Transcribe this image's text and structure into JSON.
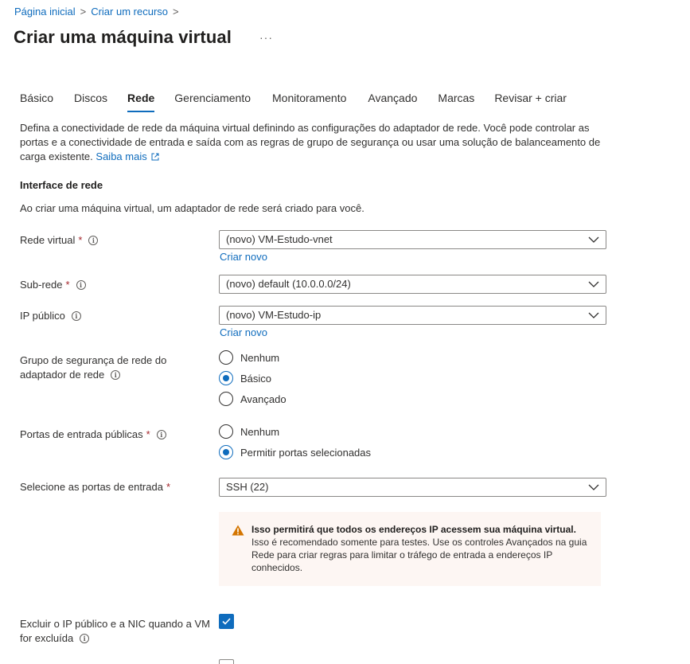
{
  "breadcrumb": {
    "home": "Página inicial",
    "create": "Criar um recurso"
  },
  "page": {
    "title": "Criar uma máquina virtual",
    "more": "···"
  },
  "tabs": [
    {
      "label": "Básico"
    },
    {
      "label": "Discos"
    },
    {
      "label": "Rede"
    },
    {
      "label": "Gerenciamento"
    },
    {
      "label": "Monitoramento"
    },
    {
      "label": "Avançado"
    },
    {
      "label": "Marcas"
    },
    {
      "label": "Revisar + criar"
    }
  ],
  "active_tab": "Rede",
  "description": {
    "text": "Defina a conectividade de rede da máquina virtual definindo as configurações do adaptador de rede. Você pode controlar as portas e a conectividade de entrada e saída com as regras de grupo de segurança ou usar uma solução de balanceamento de carga existente.",
    "link": "Saiba mais"
  },
  "section": {
    "title": "Interface de rede",
    "description": "Ao criar uma máquina virtual, um adaptador de rede será criado para você."
  },
  "fields": {
    "vnet": {
      "label": "Rede virtual",
      "required": "*",
      "value": "(novo) VM-Estudo-vnet",
      "create_link": "Criar novo"
    },
    "subnet": {
      "label": "Sub-rede",
      "required": "*",
      "value": "(novo) default (10.0.0.0/24)"
    },
    "public_ip": {
      "label": "IP público",
      "value": "(novo) VM-Estudo-ip",
      "create_link": "Criar novo"
    },
    "nsg": {
      "label_line1": "Grupo de segurança de rede do",
      "label_line2": "adaptador de rede",
      "options": [
        "Nenhum",
        "Básico",
        "Avançado"
      ],
      "selected": "Básico"
    },
    "public_ports": {
      "label": "Portas de entrada públicas",
      "required": "*",
      "options": [
        "Nenhum",
        "Permitir portas selecionadas"
      ],
      "selected": "Permitir portas selecionadas"
    },
    "inbound_ports": {
      "label": "Selecione as portas de entrada",
      "required": "*",
      "value": "SSH (22)"
    },
    "delete_ip_nic": {
      "label_line1": "Excluir o IP público e a NIC quando a VM",
      "label_line2": "for excluída",
      "checked": true
    }
  },
  "warning": {
    "title": "Isso permitirá que todos os endereços IP acessem sua máquina virtual.",
    "body": " Isso é recomendado somente para testes.  Use os controles Avançados na guia Rede para criar regras para limitar o tráfego de entrada a endereços IP conhecidos."
  },
  "colors": {
    "accent": "#0f6cbd",
    "required": "#a4262c",
    "warning_bg": "#fdf6f3",
    "warning_icon": "#d47500"
  },
  "icons": {
    "info": "info-icon",
    "chevron": "chevron-down-icon",
    "warning": "warning-icon",
    "external": "external-link-icon"
  }
}
